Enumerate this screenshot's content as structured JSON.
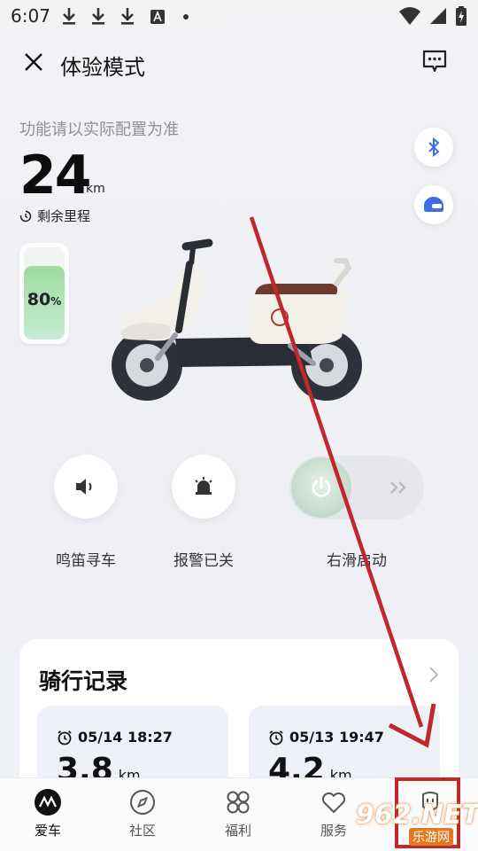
{
  "status_bar": {
    "time": "6:07"
  },
  "header": {
    "title": "体验模式"
  },
  "config_note": "功能请以实际配置为准",
  "range": {
    "value": "24",
    "unit": "km",
    "label": "剩余里程"
  },
  "battery": {
    "percent_value": "80",
    "percent_sign": "%",
    "level": 0.8
  },
  "controls": {
    "horn_label": "鸣笛寻车",
    "alarm_label": "报警已关",
    "slide_label": "右滑启动"
  },
  "ride_record": {
    "title": "骑行记录",
    "items": [
      {
        "time": "05/14 18:27",
        "distance": "3.8",
        "unit": "km"
      },
      {
        "time": "05/13 19:47",
        "distance": "4.2",
        "unit": "km"
      }
    ]
  },
  "bottom_nav": {
    "items": [
      {
        "label": "爱车",
        "icon": "brand-logo-icon"
      },
      {
        "label": "社区",
        "icon": "compass-icon"
      },
      {
        "label": "福利",
        "icon": "grid-icon"
      },
      {
        "label": "服务",
        "icon": "heart-icon"
      },
      {
        "label": "",
        "icon": "profile-icon"
      }
    ]
  },
  "watermark": {
    "brand": "962.NET",
    "sub": "乐游网"
  },
  "colors": {
    "annotation_red": "#c0282a",
    "battery_green": "#9edb9f",
    "bluetooth_blue": "#3b6ee8"
  }
}
